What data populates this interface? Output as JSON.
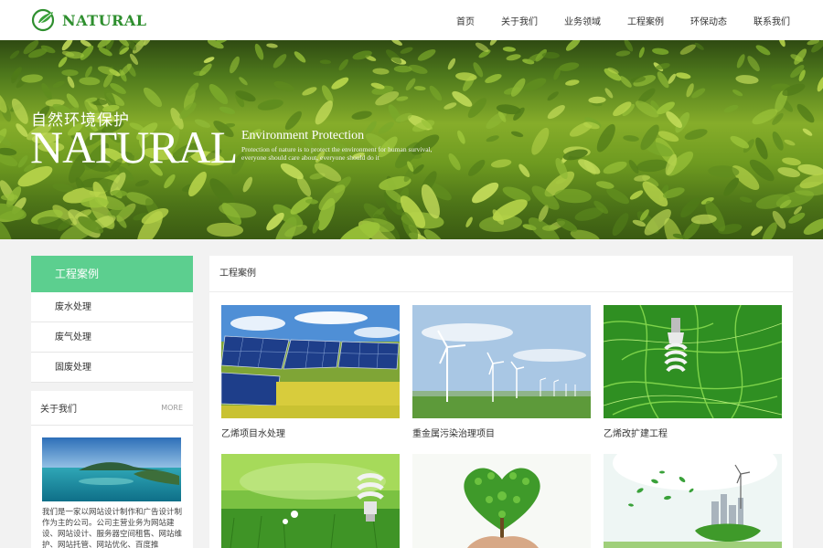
{
  "header": {
    "logo_text": "NATURAL",
    "nav": [
      "首页",
      "关于我们",
      "业务领域",
      "工程案例",
      "环保动态",
      "联系我们"
    ]
  },
  "banner": {
    "cn_title": "自然环境保护",
    "big_title": "NATURAL",
    "sub_title": "Environment Protection",
    "sub_line1": "Protection of nature is to protect the environment for human survival,",
    "sub_line2": "everyone should care about, everyone should do it"
  },
  "sidebar": {
    "title": "工程案例",
    "items": [
      "废水处理",
      "废气处理",
      "固废处理"
    ]
  },
  "about": {
    "title": "关于我们",
    "more": "MORE",
    "text": "我们是一家以网站设计制作和广告设计制作为主的公司。公司主营业务为网站建设、网站设计、服务器空间租售、网站维护、网站托管、网站优化、百度推"
  },
  "main": {
    "title": "工程案例",
    "cases": [
      {
        "label": "乙烯项目水处理",
        "image": "solar-panels"
      },
      {
        "label": "重金属污染治理项目",
        "image": "wind-turbines"
      },
      {
        "label": "乙烯改扩建工程",
        "image": "bulb-in-grass"
      },
      {
        "label": "",
        "image": "bulb-on-lawn"
      },
      {
        "label": "",
        "image": "heart-tree"
      },
      {
        "label": "",
        "image": "green-city-globe"
      }
    ]
  },
  "colors": {
    "accent": "#5ccf8f",
    "logo_green": "#2f8f2f",
    "page_bg": "#f2f2f2"
  }
}
